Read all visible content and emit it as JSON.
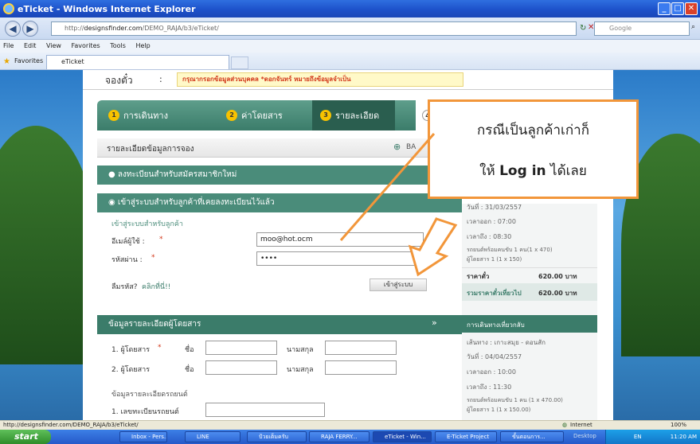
{
  "window": {
    "title": "eTicket - Windows Internet Explorer"
  },
  "address": {
    "host": "designsfinder.com",
    "prefix": "http://",
    "path": "/DEMO_RAJA/b3/eTicket/",
    "search_placeholder": "Google"
  },
  "menu": [
    "File",
    "Edit",
    "View",
    "Favorites",
    "Tools",
    "Help"
  ],
  "favorites": {
    "label": "Favorites",
    "tab": "eTicket"
  },
  "page": {
    "heading": "จองตั๋ว",
    "colon": ":",
    "warning": "กรุณากรอกข้อมูลส่วนบุคคล *ดอกจันทร์ หมายถึงข้อมูลจำเป็น",
    "steps": [
      {
        "num": "1",
        "label": "การเดินทาง"
      },
      {
        "num": "2",
        "label": "ค่าโดยสาร"
      },
      {
        "num": "3",
        "label": "รายละเอียด"
      },
      {
        "num": "4",
        "label": ""
      }
    ],
    "booking_detail_title": "รายละเอียดข้อมูลการจอง",
    "back_label": "BA",
    "register_new": "ลงทะเบียนสำหรับสมัครสมาชิกใหม่",
    "login_existing": "เข้าสู่ระบบสำหรับลูกค้าที่เคยลงทะเบียนไว้แล้ว",
    "login_sub": "เข้าสู่ระบบสำหรับลูกค้า",
    "email_label": "อีเมล์ผู้ใช้ :",
    "email_value": "moo@hot.ocm",
    "password_label": "รหัสผ่าน :",
    "password_value": "••••",
    "forgot_label": "ลืมรหัส?",
    "forgot_link": "คลิกที่นี่!!",
    "login_button": "เข้าสู่ระบบ",
    "passenger_section": "ข้อมูลรายละเอียดผู้โดยสาร",
    "passenger1": "1. ผู้โดยสาร",
    "passenger2": "2. ผู้โดยสาร",
    "first_name": "ชื่อ",
    "last_name": "นามสกุล",
    "car_section": "ข้อมูลรายละเอียดรถยนต์",
    "car_reg": "1. เลขทะเบียนรถยนต์",
    "required_mark": "*"
  },
  "sidebar": {
    "date1": "วันที่ : 31/03/2557",
    "depart1": "เวลาออก : 07:00",
    "arrive1": "เวลาถึง : 08:30",
    "car1": "รถยนต์พร้อมคนขับ 1 คน(1 x 470)",
    "pax1": "ผู้โดยสาร 1 (1 x 150)",
    "price_label": "ราคาตั๋ว",
    "price_value": "620.00 บาท",
    "total_label": "รวมราคาตั๋วเที่ยวไป",
    "total_value": "620.00 บาท",
    "return_title": "การเดินทางเที่ยวกลับ",
    "route": "เส้นทาง : เกาะสมุย - ดอนสัก",
    "date2": "วันที่ : 04/04/2557",
    "depart2": "เวลาออก : 10:00",
    "arrive2": "เวลาถึง : 11:30",
    "car2": "รถยนต์พร้อมคนขับ 1 คน (1 x 470.00)",
    "pax2": "ผู้โดยสาร 1 (1 x 150.00)"
  },
  "callout": {
    "line1": "กรณีเป็นลูกค้าเก่าก็",
    "line2_pre": "ให้ ",
    "line2_bold": "Log in",
    "line2_post": " ได้เลย"
  },
  "statusbar": {
    "url": "http://designsfinder.com/DEMO_RAJA/b3/eTicket/",
    "zone": "Internet",
    "zoom": "100%"
  },
  "taskbar": {
    "start": "start",
    "tasks": [
      "Inbox - Pers...",
      "LINE",
      "ป้วยเต็มครับ",
      "RAJA FERRY...",
      "eTicket - Win...",
      "E-Ticket Project",
      "ขั้นตอนการ..."
    ],
    "desktop": "Desktop",
    "lang": "EN",
    "clock": "11:20 AM"
  },
  "colors": {
    "accent": "#3b7c6a",
    "callout_border": "#f2963a",
    "warning": "#d2381a"
  }
}
